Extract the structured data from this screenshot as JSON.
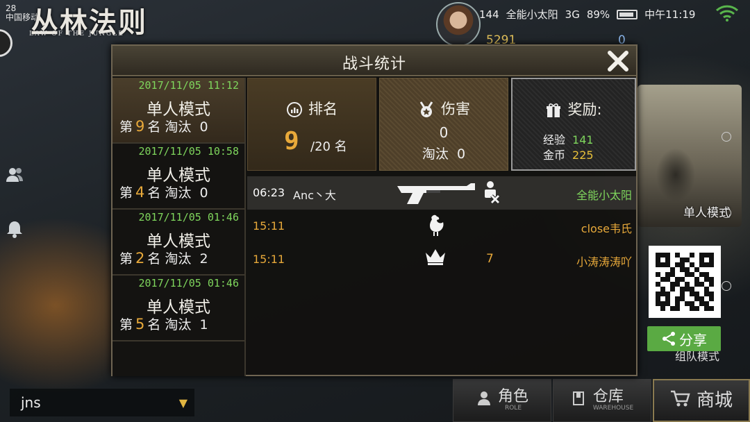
{
  "status_bar": {
    "left_line1": "28",
    "left_line2": "中国移动",
    "center_text": "144",
    "player_name": "全能小太阳",
    "signal": "3G",
    "battery": "89%",
    "clock": "中午11:19"
  },
  "game_logo": {
    "title": "丛林法则",
    "subtitle": "LAW OF THE JUNGLE"
  },
  "currency": {
    "coins": "5291",
    "diamonds": "0"
  },
  "dialog": {
    "title": "战斗统计",
    "close_icon": "close-icon"
  },
  "matches": [
    {
      "date": "2017/11/05 11:12",
      "mode": "单人模式",
      "rank_prefix": "第",
      "rank": "9",
      "rank_suffix": "名 淘汰",
      "kills": "0",
      "active": true
    },
    {
      "date": "2017/11/05 10:58",
      "mode": "单人模式",
      "rank_prefix": "第",
      "rank": "4",
      "rank_suffix": "名 淘汰",
      "kills": "0",
      "active": false
    },
    {
      "date": "2017/11/05 01:46",
      "mode": "单人模式",
      "rank_prefix": "第",
      "rank": "2",
      "rank_suffix": "名 淘汰",
      "kills": "2",
      "active": false
    },
    {
      "date": "2017/11/05 01:46",
      "mode": "单人模式",
      "rank_prefix": "第",
      "rank": "5",
      "rank_suffix": "名 淘汰",
      "kills": "1",
      "active": false
    }
  ],
  "summary": {
    "rank_label": "排名",
    "rank_value": "9",
    "rank_total": "/20 名",
    "damage_label": "伤害",
    "damage_value": "0",
    "kills_label": "淘汰",
    "kills_value": "0",
    "reward_label": "奖励:",
    "exp_label": "经验",
    "exp_value": "141",
    "gold_label": "金币",
    "gold_value": "225"
  },
  "events": [
    {
      "time": "06:23",
      "actor": "Anc丶大",
      "icon": "shotgun-icon",
      "icon2": "knocked-out-icon",
      "count": "",
      "target": "全能小太阳",
      "time_color": "#ffffff",
      "target_color": "#7fd65d"
    },
    {
      "time": "15:11",
      "actor": "",
      "icon": "chicken-icon",
      "icon2": "",
      "count": "",
      "target": "close韦氏",
      "time_color": "#e8a93a",
      "target_color": "#e8a93a"
    },
    {
      "time": "15:11",
      "actor": "",
      "icon": "crown-icon",
      "icon2": "",
      "count": "7",
      "target": "小涛涛涛吖",
      "time_color": "#e8a93a",
      "target_color": "#e8a93a"
    }
  ],
  "right_panel": {
    "mode_label": "单人模式",
    "share_label": "分享",
    "team_mode_label": "组队模式"
  },
  "bottom": {
    "server_value": "jns",
    "role_label": "角色",
    "role_sub": "ROLE",
    "warehouse_label": "仓库",
    "warehouse_sub": "WAREHOUSE",
    "shop_label": "商城"
  }
}
